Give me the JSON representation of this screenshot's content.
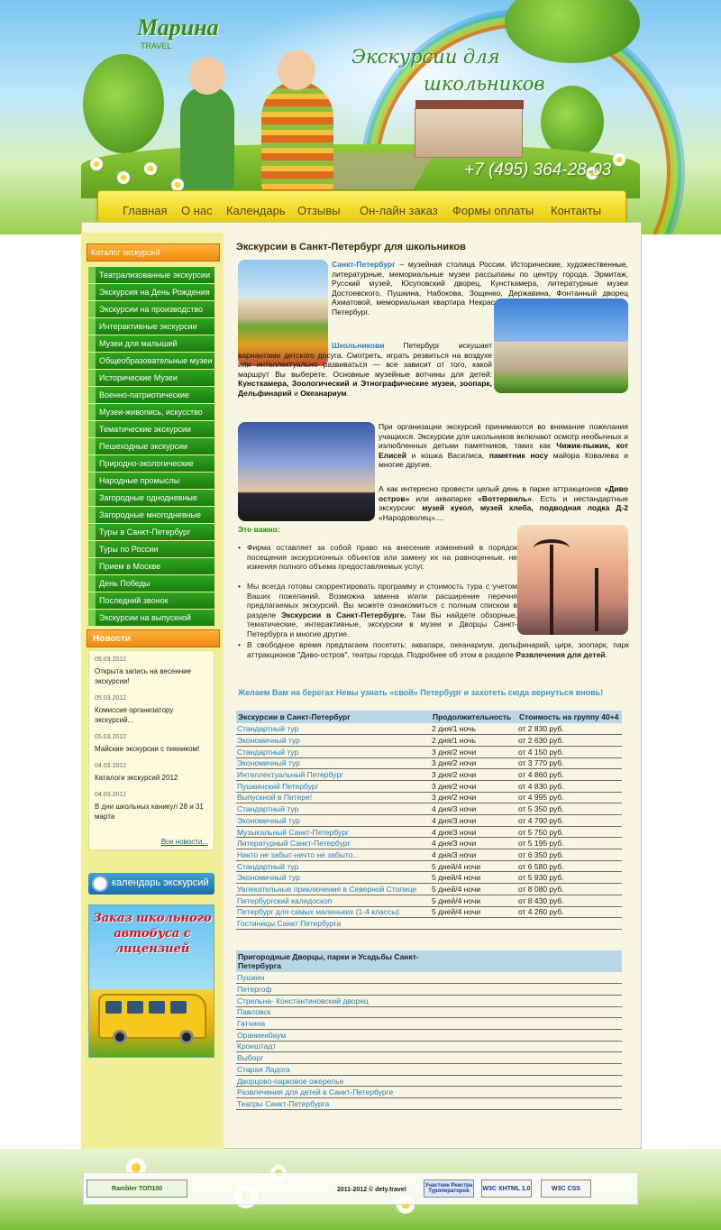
{
  "brand": {
    "name": "Марина",
    "sub": "TRAVEL"
  },
  "slogan": {
    "line1": "Экскурсии для",
    "line2": "школьников"
  },
  "phone": "+7 (495) 364-28-03",
  "nav": [
    "Главная",
    "О нас",
    "Календарь",
    "Отзывы",
    "Он-лайн заказ",
    "Формы оплаты",
    "Контакты"
  ],
  "catalog": {
    "title": "Каталог экскурсий",
    "items": [
      "Театрализованные экскурсии",
      "Экскурсия на День Рождения",
      "Экскурсии на производство",
      "Интерактивные экскурсии",
      "Музеи для малышей",
      "Общеобразовательные музеи",
      "Исторические Музеи",
      "Военно-патриотические",
      "Музеи-живопись, искусство",
      "Тематические экскурсии",
      "Пешеходные экскурсии",
      "Природно-экологические",
      "Народные промыслы",
      "Загородные однодневные",
      "Загородные многодневные",
      "Туры в Санкт-Петербург",
      "Туры по России",
      "Прием в Москве",
      "День Победы",
      "Последний звонок",
      "Экскурсии на выпускной"
    ]
  },
  "news": {
    "title": "Новости",
    "items": [
      {
        "date": "05.03.2012",
        "title": "Открыта запись на весенние экскурсии!"
      },
      {
        "date": "05.03.2012",
        "title": "Комиссия организатору экскурсий..."
      },
      {
        "date": "05.03.2012",
        "title": "Майские экскурсии с пикником!"
      },
      {
        "date": "04.03.2012",
        "title": "Каталоги экскурсий 2012"
      },
      {
        "date": "04.03.2012",
        "title": "В дни школьных каникул 28 и 31 марта"
      }
    ],
    "all_link": "Все новости..."
  },
  "calendar_banner": "календарь экскурсий",
  "bus_banner": "Заказ школьного автобуса с лицензией",
  "content": {
    "title": "Экскурсии в Санкт-Петербург для школьников",
    "p1_link": "Санкт-Петербург",
    "p1": "– музейная столица России. Исторические, художественные, литературные, мемориальные музеи рассыпаны по центру города. Эрмитаж, Русский музей, Юсуповский дворец, Кунсткамера, литературные музеи Достоевского, Пушкина, Набокова, Зощенко, Державина, Фонтанный дворец Ахматовой, мемориальная квартира Некрасова – то, ради чего стоит посетить Петербург.",
    "p2_link": "Школьникови",
    "p2": "Петербург искушает вариантами детского досуга. Смотреть, играть резвиться на воздухе или интеллектуально развиваться — все зависит от того, какой маршрут Вы выберете. Основные музейные вотчины для детей:",
    "p2_bold": "Кунсткамера, Зоологический и Этнографические музеи, зоопарк, Дельфинарий",
    "p2_and": "и",
    "p2_bold2": "Океанариум",
    "p2_end": ".",
    "p3a": "При организации экскурсий принимаются во внимание пожелания учащихся. Экскурсии для школьников включают осмотр необычных и излюбленных детьми памятников, таких как",
    "p3b": "Чижик-пыжик, кот Елисей",
    "p3c": "и кошка Василиса,",
    "p3d": "памятник носу",
    "p3e": "майора Ковалева и многие другие.",
    "p4a": "А как интересно провести целый день в парке аттракционов",
    "p4b": "«Диво остров»",
    "p4c": "или аквапарке",
    "p4d": "«Воттервиль»",
    "p4e": ". Есть и нестандартные экскурсии:",
    "p4f": "музей кукол, музей хлеба, подводная лодка Д-2",
    "p4g": "«Народоволец»....",
    "important": "Это важно:",
    "b1": "Фирма оставляет за собой право на внесение изменений в порядок посещения экскурсионных объектов или замену их на равноценные, не изменяя полного объема предоставляемых услуг.",
    "b2a": "Мы всегда готовы скорректировать программу и стоимость тура с учетом Ваших пожеланий. Возможна замена и/или расширение перечня предлагаемых экскурсий. Вы можете ознакомиться с полным списком в разделе",
    "b2b": "Экскурсии в Санкт-Петербурге.",
    "b2c": "Там Вы найдете обзорные, тематические, интерактивные, экскурсии в музеи и Дворцы Санкт-Петербурга и многие другие.",
    "b3a": "В свободное время предлагаем посетить: аквапарк, океанариум, дельфинарий, цирк, зоопарк, парк аттракционов \"Диво-остров\", театры города. Подробнее об этом в разделе",
    "b3b": "Развлечения для детей",
    "b3c": ".",
    "wish": "Желаем Вам на берегах Невы узнать «свой» Петербург и захотеть сюда вернуться вновь!"
  },
  "tours_table": {
    "headers": [
      "Экскурсии в Санкт-Петербург",
      "Продолжительность",
      "Стоимость на группу 40+4"
    ],
    "rows": [
      [
        "Стандартный тур",
        "2 дня/1 ночь",
        "от 2 830 руб."
      ],
      [
        "Экономичный тур",
        "2 дня/1 ночь",
        "от 2 630 руб."
      ],
      [
        "Стандартный тур",
        "3 дня/2 ночи",
        "от 4 150 руб."
      ],
      [
        "Экономичный тур",
        "3 дня/2 ночи",
        "от 3 770 руб."
      ],
      [
        "Интеллектуальный Петербург",
        "3 дня/2 ночи",
        "от 4 860 руб."
      ],
      [
        "Пушкинский Петербург",
        "3 дня/2 ночи",
        "от 4 830 руб."
      ],
      [
        "Выпускной в Питере!",
        "3 дня/2 ночи",
        "от 4 995 руб."
      ],
      [
        "Стандартный тур",
        "4 дня/3 ночи",
        "от 5 350 руб."
      ],
      [
        "Экономичный тур",
        "4 дня/3 ночи",
        "от 4 790 руб."
      ],
      [
        "Музыкальный Санкт-Петербург",
        "4 дня/3 ночи",
        "от 5 750 руб."
      ],
      [
        "Литературный Санкт-Петербург",
        "4 дня/3 ночи",
        "от 5 195 руб."
      ],
      [
        "Никто не забыт-ничто не забыто...",
        "4 дня/3 ночи",
        "от 6 350 руб."
      ],
      [
        "Стандартный тур",
        "5 дней/4 ночи",
        "от 6 580 руб."
      ],
      [
        "Экономичный тур",
        "5 дней/4 ночи",
        "от 5 930 руб."
      ],
      [
        "Увлекательные приключения в Северной Столице",
        "5 дней/4 ночи",
        "от 8 080 руб."
      ],
      [
        "Петербургский каледоскоп",
        "5 дней/4 ночи",
        "от 8 430 руб."
      ],
      [
        "Петербург для самых маленьких (1-4 классы)",
        "5 дней/4 ночи",
        "от 4 260 руб."
      ],
      [
        "Гостиницы Санкт Петербурга",
        "",
        ""
      ]
    ]
  },
  "suburbs_table": {
    "header": "Пригородные Дворцы, парки и Усадьбы Санкт-Петербурга",
    "rows": [
      "Пушкин",
      "Петергоф",
      "Стрельна- Константиновский дворец",
      "Павловск",
      "Гатчина",
      "Ораниенбаум",
      "Кронштадт",
      "Выборг",
      "Старая Ладога",
      "Дворцово-парковое ожерелье",
      "Развлечения для детей в Санкт-Петербурге",
      "Театры Санкт-Петербурга"
    ]
  },
  "footer": {
    "copyright": "2011-2012 © dety.travel",
    "badges": [
      "Rambler ТОП100",
      "Участник Реестра Туроператоров",
      "W3C XHTML 1.0",
      "W3C CSS"
    ]
  }
}
